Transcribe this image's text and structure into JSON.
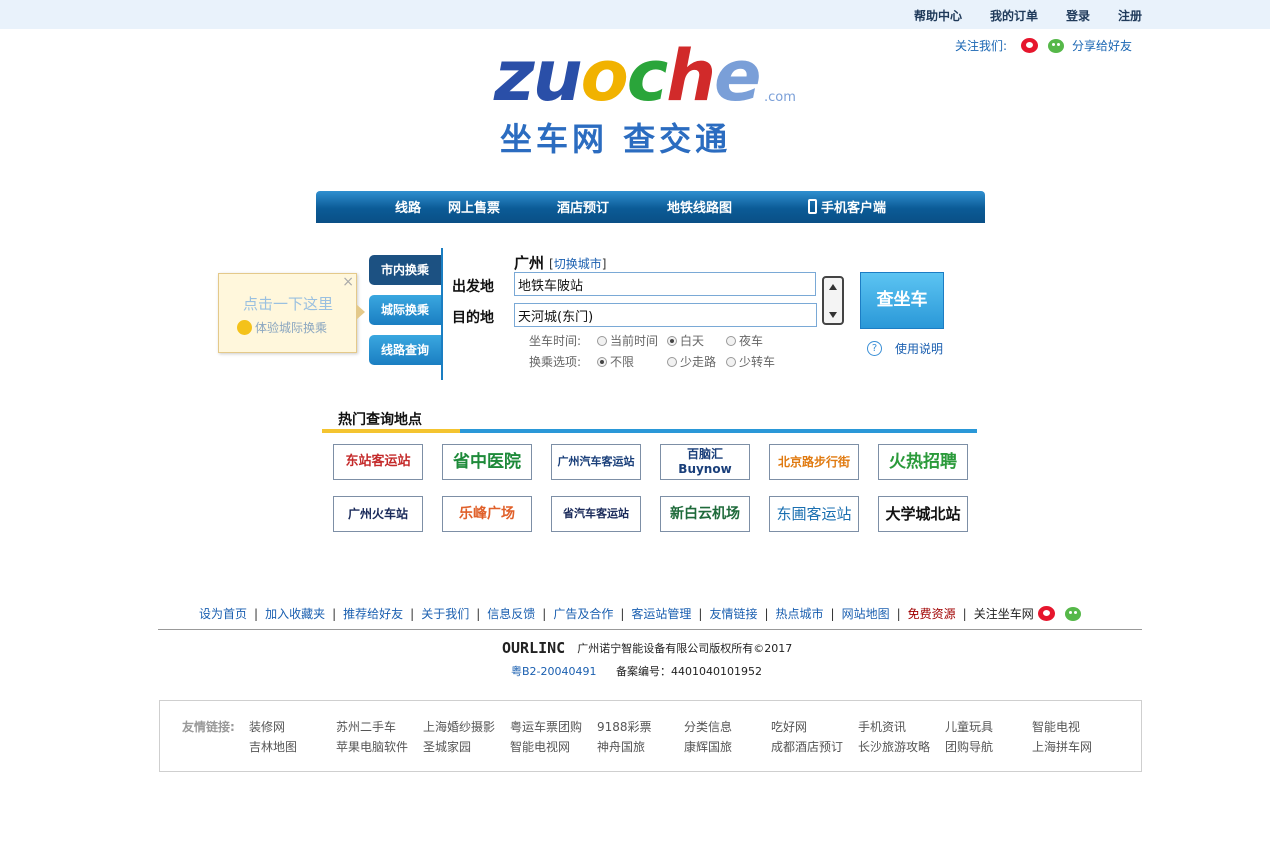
{
  "top_links": [
    "帮助中心",
    "我的订单",
    "登录",
    "注册"
  ],
  "follow": {
    "label": "关注我们:",
    "share": "分享给好友"
  },
  "logo": {
    "word": "zuoche",
    "dotcom": ".com",
    "cn": "坐车网 查交通"
  },
  "nav": [
    "线路",
    "网上售票",
    "酒店预订",
    "地铁线路图",
    "手机客户端"
  ],
  "tooltip": {
    "line1": "点击一下这里",
    "line2": "体验城际换乘",
    "close": "×"
  },
  "side_tabs": [
    "市内换乘",
    "城际换乘",
    "线路查询"
  ],
  "city": {
    "name": "广州",
    "switch": "切换城市"
  },
  "form": {
    "from_label": "出发地",
    "from_value": "地铁车陂站",
    "to_label": "目的地",
    "to_value": "天河城(东门)",
    "search_button": "查坐车",
    "help": "使用说明",
    "time_label": "坐车时间:",
    "time_options": [
      "当前时间",
      "白天",
      "夜车"
    ],
    "time_selected": "白天",
    "transfer_label": "换乘选项:",
    "transfer_options": [
      "不限",
      "少走路",
      "少转车"
    ],
    "transfer_selected": "不限"
  },
  "hot": {
    "title": "热门查询地点",
    "row1": [
      "东站客运站",
      "省中医院",
      "广州汽车客运站",
      "百脑汇 Buynow",
      "北京路步行街",
      "火热招聘"
    ],
    "row2": [
      "广州火车站",
      "乐峰广场",
      "省汽车客运站",
      "新白云机场",
      "东圃客运站",
      "大学城北站"
    ]
  },
  "footer": {
    "links": [
      "设为首页",
      "加入收藏夹",
      "推荐给好友",
      "关于我们",
      "信息反馈",
      "广告及合作",
      "客运站管理",
      "友情链接",
      "热点城市",
      "网站地图",
      "免费资源",
      "关注坐车网"
    ],
    "ourlinc": "OURLINC",
    "copyright": "广州诺宁智能设备有限公司版权所有©2017",
    "icp": "粤B2-20040491",
    "beian": "备案编号：4401040101952"
  },
  "friends": {
    "title": "友情链接:",
    "row1": [
      "装修网",
      "苏州二手车",
      "上海婚纱摄影",
      "粤运车票团购",
      "9188彩票",
      "分类信息",
      "吃好网",
      "手机资讯",
      "儿童玩具",
      "智能电视"
    ],
    "row2": [
      "吉林地图",
      "苹果电脑软件",
      "圣城家园",
      "智能电视网",
      "神舟国旅",
      "康辉国旅",
      "成都酒店预订",
      "长沙旅游攻略",
      "团购导航",
      "上海拼车网"
    ]
  }
}
